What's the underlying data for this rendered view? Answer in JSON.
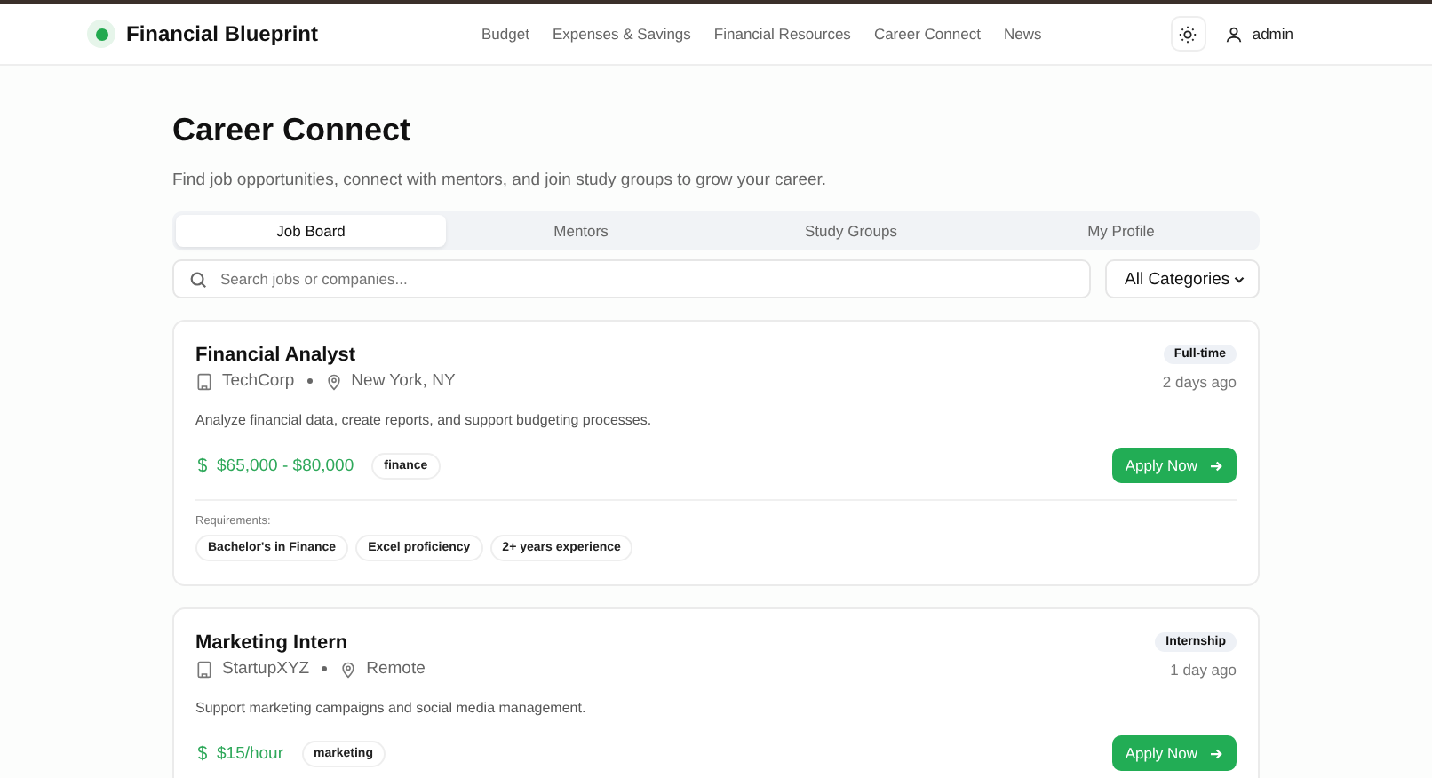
{
  "brand": {
    "name": "Financial Blueprint"
  },
  "nav": [
    "Budget",
    "Expenses & Savings",
    "Financial Resources",
    "Career Connect",
    "News"
  ],
  "user": {
    "name": "admin"
  },
  "page": {
    "title": "Career Connect",
    "subtitle": "Find job opportunities, connect with mentors, and join study groups to grow your career."
  },
  "tabs": [
    {
      "label": "Job Board",
      "selected": true
    },
    {
      "label": "Mentors",
      "selected": false
    },
    {
      "label": "Study Groups",
      "selected": false
    },
    {
      "label": "My Profile",
      "selected": false
    }
  ],
  "search": {
    "placeholder": "Search jobs or companies..."
  },
  "category_filter": {
    "value": "All Categories"
  },
  "jobs": [
    {
      "title": "Financial Analyst",
      "company": "TechCorp",
      "location": "New York, NY",
      "type": "Full-time",
      "posted": "2 days ago",
      "description": "Analyze financial data, create reports, and support budgeting processes.",
      "salary": "$65,000 - $80,000",
      "tag": "finance",
      "button": "Apply Now",
      "requirements_label": "Requirements:",
      "requirements": [
        "Bachelor's in Finance",
        "Excel proficiency",
        "2+ years experience"
      ]
    },
    {
      "title": "Marketing Intern",
      "company": "StartupXYZ",
      "location": "Remote",
      "type": "Internship",
      "posted": "1 day ago",
      "description": "Support marketing campaigns and social media management.",
      "salary": "$15/hour",
      "tag": "marketing",
      "button": "Apply Now"
    }
  ]
}
